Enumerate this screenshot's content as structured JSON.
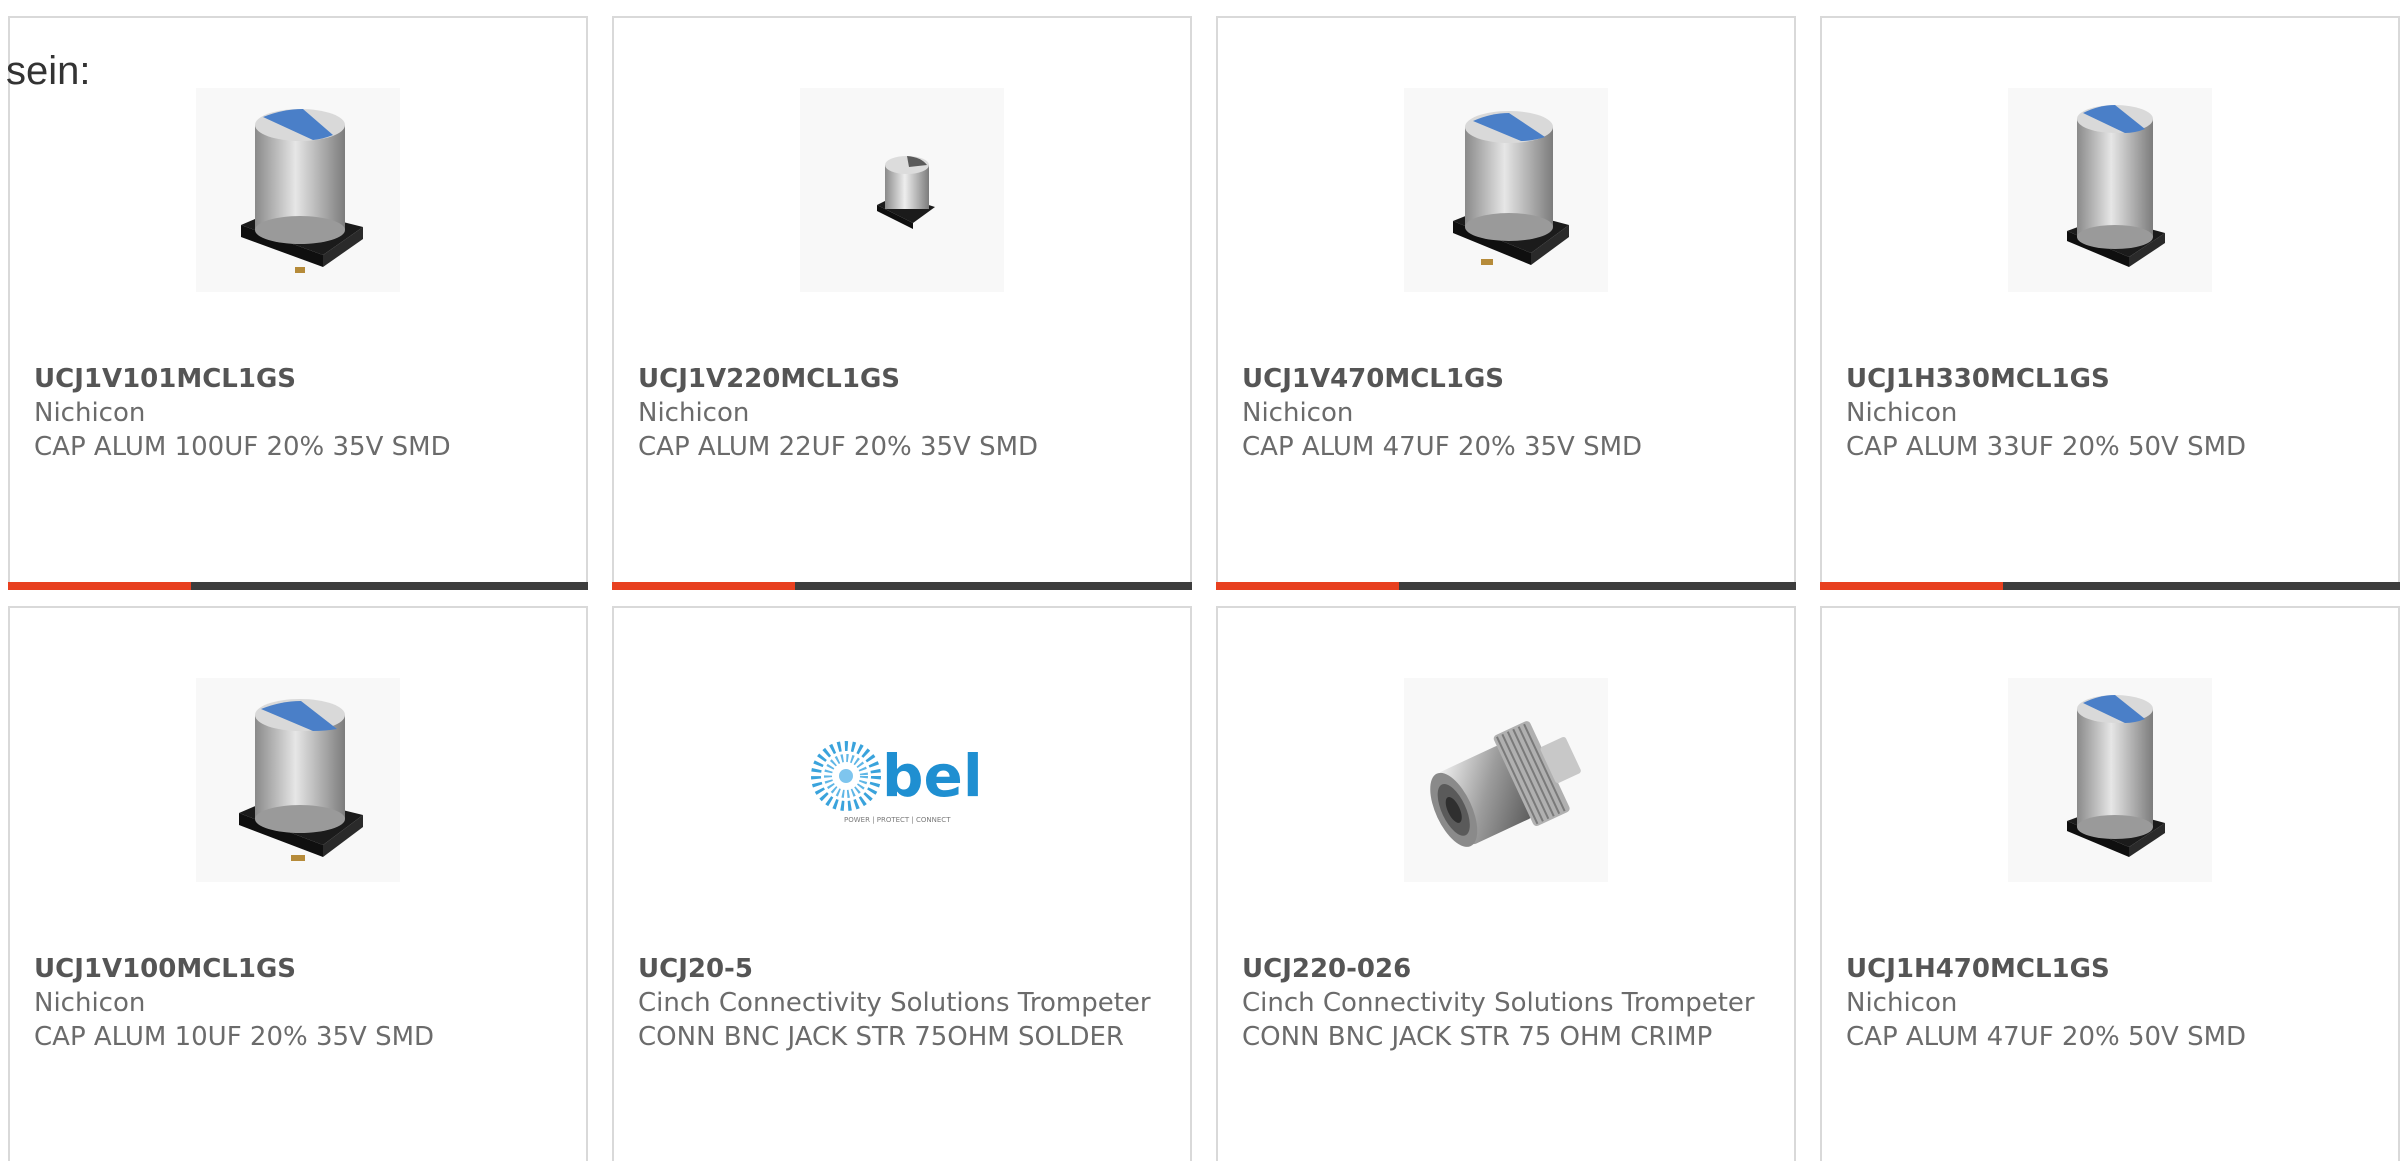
{
  "heading": "sein:",
  "colors": {
    "accent": "#e8401f",
    "bar": "#3d3d3d",
    "border": "#d9d9d9",
    "cap_blue": "#4a7fc8",
    "bel_blue": "#1f8fd1"
  },
  "products": [
    {
      "part": "UCJ1V101MCL1GS",
      "mfr": "Nichicon",
      "desc": "CAP ALUM 100UF 20% 35V SMD",
      "image": "smd-capacitor-icon"
    },
    {
      "part": "UCJ1V220MCL1GS",
      "mfr": "Nichicon",
      "desc": "CAP ALUM 22UF 20% 35V SMD",
      "image": "smd-capacitor-small-icon"
    },
    {
      "part": "UCJ1V470MCL1GS",
      "mfr": "Nichicon",
      "desc": "CAP ALUM 47UF 20% 35V SMD",
      "image": "smd-capacitor-icon"
    },
    {
      "part": "UCJ1H330MCL1GS",
      "mfr": "Nichicon",
      "desc": "CAP ALUM 33UF 20% 50V SMD",
      "image": "smd-capacitor-tall-icon"
    },
    {
      "part": "UCJ1V100MCL1GS",
      "mfr": "Nichicon",
      "desc": "CAP ALUM 10UF 20% 35V SMD",
      "image": "smd-capacitor-icon"
    },
    {
      "part": "UCJ20-5",
      "mfr": "Cinch Connectivity Solutions Trompeter",
      "desc": "CONN BNC JACK STR 75OHM SOLDER",
      "image": "bel-logo"
    },
    {
      "part": "UCJ220-026",
      "mfr": "Cinch Connectivity Solutions Trompeter",
      "desc": "CONN BNC JACK STR 75 OHM CRIMP",
      "image": "bnc-connector-icon"
    },
    {
      "part": "UCJ1H470MCL1GS",
      "mfr": "Nichicon",
      "desc": "CAP ALUM 47UF 20% 50V SMD",
      "image": "smd-capacitor-tall-icon"
    }
  ],
  "bel_logo": {
    "wordmark": "bel",
    "tagline": "POWER | PROTECT | CONNECT"
  }
}
